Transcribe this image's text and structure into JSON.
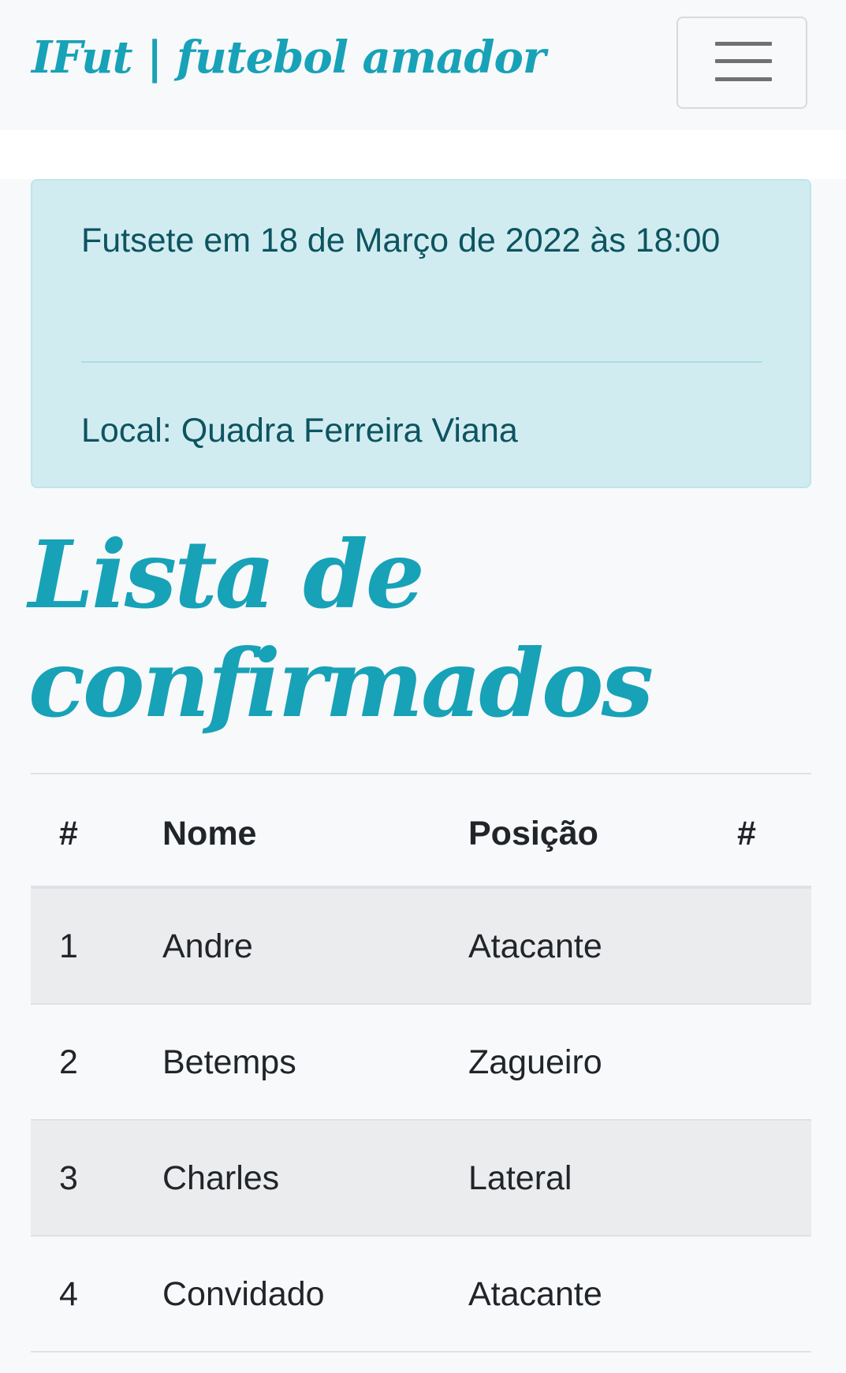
{
  "navbar": {
    "brand": "IFut | futebol amador",
    "toggler_icon": "hamburger-menu-icon"
  },
  "event": {
    "title": "Futsete em 18 de Março de 2022 às 18:00",
    "location": "Local: Quadra Ferreira Viana"
  },
  "list": {
    "heading": "Lista de confirmados",
    "columns": [
      "#",
      "Nome",
      "Posição",
      "#"
    ],
    "rows": [
      {
        "num": "1",
        "name": "Andre",
        "position": "Atacante",
        "action": ""
      },
      {
        "num": "2",
        "name": "Betemps",
        "position": "Zagueiro",
        "action": ""
      },
      {
        "num": "3",
        "name": "Charles",
        "position": "Lateral",
        "action": ""
      },
      {
        "num": "4",
        "name": "Convidado",
        "position": "Atacante",
        "action": ""
      }
    ]
  },
  "colors": {
    "accent": "#17a2b8",
    "alert_background": "#d1ecf1",
    "alert_text": "#0c5460",
    "page_background": "#f8f9fa"
  }
}
